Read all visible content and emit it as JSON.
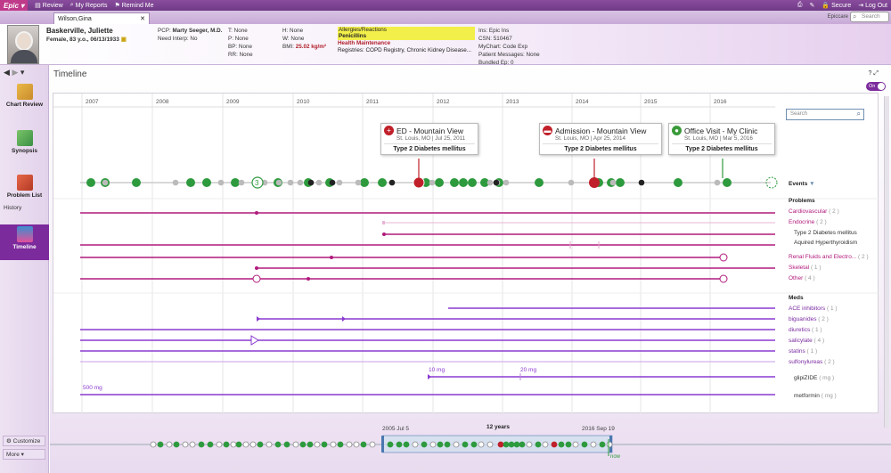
{
  "topbar": {
    "brand": "Epic",
    "review": "Review",
    "my_reports": "My Reports",
    "remind_me": "Remind Me",
    "secure": "Secure",
    "log_out": "Log Out"
  },
  "tabs": {
    "patient_tab": "Wilson,Gina",
    "epiccare": "Epiccare",
    "search_placeholder": "Search"
  },
  "patient": {
    "name": "Baskerville, Juliette",
    "demographics": "Female, 83 y.o., 06/13/1933",
    "pcp_label": "PCP:",
    "pcp": "Marty Seeger, M.D.",
    "need_interp": "Need Interp: No",
    "t": "T: None",
    "p": "P: None",
    "bp": "BP: None",
    "rr": "RR: None",
    "h": "H: None",
    "w": "W: None",
    "bmi_label": "BMI:",
    "bmi": "25.02 kg/m²",
    "allergies_title": "Allergies/Reactions",
    "allergies": "Penicillins",
    "health_maint_title": "Health Maintenance",
    "registries": "Registries: COPD Registry, Chronic Kidney Disease...",
    "ins": "Ins: Epic Ins",
    "csn": "CSN: 510467",
    "mychart": "MyChart: Code Exp",
    "patient_messages": "Patient Messages: None",
    "bundled_ep": "Bundled Ep: 0"
  },
  "sidebar": {
    "items": [
      {
        "label": "Chart Review",
        "icon": "chart-review-icon"
      },
      {
        "label": "Synopsis",
        "icon": "synopsis-icon"
      },
      {
        "label": "Problem List",
        "icon": "problem-list-icon"
      },
      {
        "label": "Timeline",
        "icon": "timeline-icon"
      }
    ],
    "history": "History",
    "customize": "Customize",
    "more": "More"
  },
  "timeline": {
    "title": "Timeline",
    "toggle": "On",
    "years": [
      "2007",
      "2008",
      "2009",
      "2010",
      "2011",
      "2012",
      "2013",
      "2014",
      "2015",
      "2016"
    ],
    "search_placeholder": "Search",
    "events_label": "Events",
    "encounter_count": "3",
    "popups": [
      {
        "title": "ED - Mountain View",
        "sub": "St. Louis, MO | Jul 25, 2011",
        "dx": "Type 2 Diabetes mellitus",
        "color": "#c0202a"
      },
      {
        "title": "Admission - Mountain View",
        "sub": "St. Louis, MO | Apr 25, 2014",
        "dx": "Type 2 Diabetes mellitus",
        "color": "#c0202a"
      },
      {
        "title": "Office Visit - My Clinic",
        "sub": "St. Louis, MO | Mar 5, 2016",
        "dx": "Type 2 Diabetes mellitus",
        "color": "#3a9a3a"
      }
    ],
    "problems_title": "Problems",
    "problems": [
      {
        "name": "Cardiovascular",
        "count": "( 2 )"
      },
      {
        "name": "Endocrine",
        "count": "( 2 )"
      },
      {
        "name": "Renal Fluids and Electro...",
        "count": "( 2 )"
      },
      {
        "name": "Skeletal",
        "count": "( 1 )"
      },
      {
        "name": "Other",
        "count": "( 4 )"
      }
    ],
    "endocrine_sub": [
      "Type 2 Diabetes mellitus",
      "Aquired Hyperthyroidism"
    ],
    "meds_title": "Meds",
    "meds": [
      {
        "name": "ACE inhibitors",
        "count": "( 1 )"
      },
      {
        "name": "biguanides",
        "count": "( 2 )"
      },
      {
        "name": "diuretics",
        "count": "( 1 )"
      },
      {
        "name": "salicylate",
        "count": "( 4 )"
      },
      {
        "name": "statins",
        "count": "( 1 )"
      },
      {
        "name": "sulfonylureas",
        "count": "( 2 )"
      }
    ],
    "glipizide": {
      "name": "glipiZIDE",
      "unit": "( mg )",
      "dose1": "10 mg",
      "dose2": "20 mg"
    },
    "metformin": {
      "name": "metformin",
      "unit": "( mg )",
      "dose": "500 mg"
    }
  },
  "navigator": {
    "start": "2005 Jul 5",
    "span": "12 years",
    "end": "2016 Sep 19",
    "now": "now"
  },
  "colors": {
    "accent": "#7c2b9c",
    "problem": "#b01a7c",
    "med": "#8a3ad0",
    "encounter_green": "#2e9a3e",
    "encounter_red": "#c0202a"
  }
}
